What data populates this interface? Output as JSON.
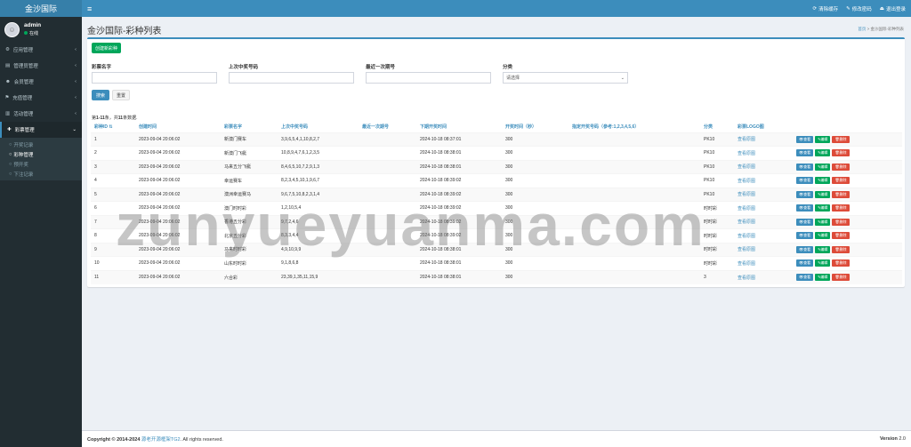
{
  "app": {
    "logo": "金沙国际"
  },
  "topbar": {
    "menu_icon": "≡",
    "actions": [
      {
        "icon": "⟳",
        "label": "清除缓存"
      },
      {
        "icon": "✎",
        "label": "修改密码"
      },
      {
        "icon": "⏏",
        "label": "退出登录"
      }
    ]
  },
  "user": {
    "name": "admin",
    "status": "在线"
  },
  "sidebar": {
    "items": [
      {
        "icon": "⚙",
        "label": "应用管理"
      },
      {
        "icon": "▤",
        "label": "管理员管理"
      },
      {
        "icon": "☻",
        "label": "会员管理"
      },
      {
        "icon": "⚑",
        "label": "充值管理"
      },
      {
        "icon": "▥",
        "label": "活动管理"
      },
      {
        "icon": "✚",
        "label": "彩票管理"
      }
    ],
    "submenu": [
      {
        "label": "开奖记录"
      },
      {
        "label": "彩种管理"
      },
      {
        "label": "预开奖"
      },
      {
        "label": "下注记录"
      }
    ]
  },
  "page": {
    "title": "金沙国际-彩种列表",
    "breadcrumb_home": "首页",
    "breadcrumb_sep": ">",
    "breadcrumb_current": "金沙国际-彩种列表"
  },
  "toolbar": {
    "create_label": "创建新彩种"
  },
  "filters": {
    "name_label": "彩票名字",
    "last_number_label": "上次中奖号码",
    "last_issue_label": "最近一次期号",
    "category_label": "分类",
    "category_placeholder": "请选择",
    "search_label": "搜索",
    "reset_label": "重置"
  },
  "summary": {
    "prefix": "第",
    "range": "1-11",
    "middle": "条，共",
    "total": "11",
    "suffix": "条数据."
  },
  "table": {
    "headers": [
      "彩种ID ⇅",
      "创建时间",
      "彩票名字",
      "上次中奖号码",
      "最近一次期号",
      "下期开奖时间",
      "开奖时间（秒）",
      "指定开奖号码（参考:1,2,3,4,5,6）",
      "分类",
      "彩票LOGO图",
      ""
    ],
    "rows": [
      {
        "id": "1",
        "created": "2023-09-04 20:06:02",
        "name": "新澳门赛车",
        "last_number": "3,9,6,5,4,1,10,8,2,7",
        "last_issue": "",
        "next_time": "2024-10-18 08:37:01",
        "interval": "300",
        "assigned": "",
        "category": "PK10",
        "logo": "查看原图"
      },
      {
        "id": "2",
        "created": "2023-09-04 20:06:02",
        "name": "新澳门飞艇",
        "last_number": "10,8,9,4,7,6,1,2,3,5",
        "last_issue": "",
        "next_time": "2024-10-18 08:38:01",
        "interval": "300",
        "assigned": "",
        "category": "PK10",
        "logo": "查看原图"
      },
      {
        "id": "3",
        "created": "2023-09-04 20:06:02",
        "name": "马来五分飞艇",
        "last_number": "8,4,6,5,10,7,2,9,1,3",
        "last_issue": "",
        "next_time": "2024-10-18 08:38:01",
        "interval": "300",
        "assigned": "",
        "category": "PK10",
        "logo": "查看原图"
      },
      {
        "id": "4",
        "created": "2023-09-04 20:06:02",
        "name": "幸运赛车",
        "last_number": "8,2,3,4,5,10,1,9,6,7",
        "last_issue": "",
        "next_time": "2024-10-18 08:39:02",
        "interval": "300",
        "assigned": "",
        "category": "PK10",
        "logo": "查看原图"
      },
      {
        "id": "5",
        "created": "2023-09-04 20:06:02",
        "name": "澳洲幸运赛马",
        "last_number": "9,6,7,5,10,8,2,3,1,4",
        "last_issue": "",
        "next_time": "2024-10-18 08:39:02",
        "interval": "300",
        "assigned": "",
        "category": "PK10",
        "logo": "查看原图"
      },
      {
        "id": "6",
        "created": "2023-09-04 20:06:02",
        "name": "澳门时时彩",
        "last_number": "1,2,10,5,4",
        "last_issue": "",
        "next_time": "2024-10-18 08:39:02",
        "interval": "300",
        "assigned": "",
        "category": "时时彩",
        "logo": "查看原图"
      },
      {
        "id": "7",
        "created": "2023-09-04 20:06:02",
        "name": "香港五分彩",
        "last_number": "9,7,2,4,6",
        "last_issue": "",
        "next_time": "2024-10-18 08:39:02",
        "interval": "300",
        "assigned": "",
        "category": "时时彩",
        "logo": "查看原图"
      },
      {
        "id": "8",
        "created": "2023-09-04 20:06:02",
        "name": "北京五分彩",
        "last_number": "8,3,3,4,4",
        "last_issue": "",
        "next_time": "2024-10-18 08:39:02",
        "interval": "300",
        "assigned": "",
        "category": "时时彩",
        "logo": "查看原图"
      },
      {
        "id": "9",
        "created": "2023-09-04 20:06:02",
        "name": "马来时时彩",
        "last_number": "4,9,10,9,9",
        "last_issue": "",
        "next_time": "2024-10-18 08:38:01",
        "interval": "300",
        "assigned": "",
        "category": "时时彩",
        "logo": "查看原图"
      },
      {
        "id": "10",
        "created": "2023-09-04 20:06:02",
        "name": "山东时时彩",
        "last_number": "9,1,8,6,8",
        "last_issue": "",
        "next_time": "2024-10-18 08:38:01",
        "interval": "300",
        "assigned": "",
        "category": "时时彩",
        "logo": "查看原图"
      },
      {
        "id": "11",
        "created": "2023-09-04 20:06:02",
        "name": "六合彩",
        "last_number": "23,39,1,35,11,15,9",
        "last_issue": "",
        "next_time": "2024-10-18 08:38:01",
        "interval": "300",
        "assigned": "",
        "category": "3",
        "logo": "查看原图"
      }
    ],
    "actions": {
      "view": "👁查看",
      "edit": "✎编辑",
      "delete": "🗑删除"
    }
  },
  "watermark": "zunyueyuanma.com",
  "footer": {
    "copyright": "Copyright © 2014-2024",
    "link": "源老开源框架TG2",
    "rights": ". All rights reserved.",
    "version_label": "Version",
    "version": "2.0"
  }
}
